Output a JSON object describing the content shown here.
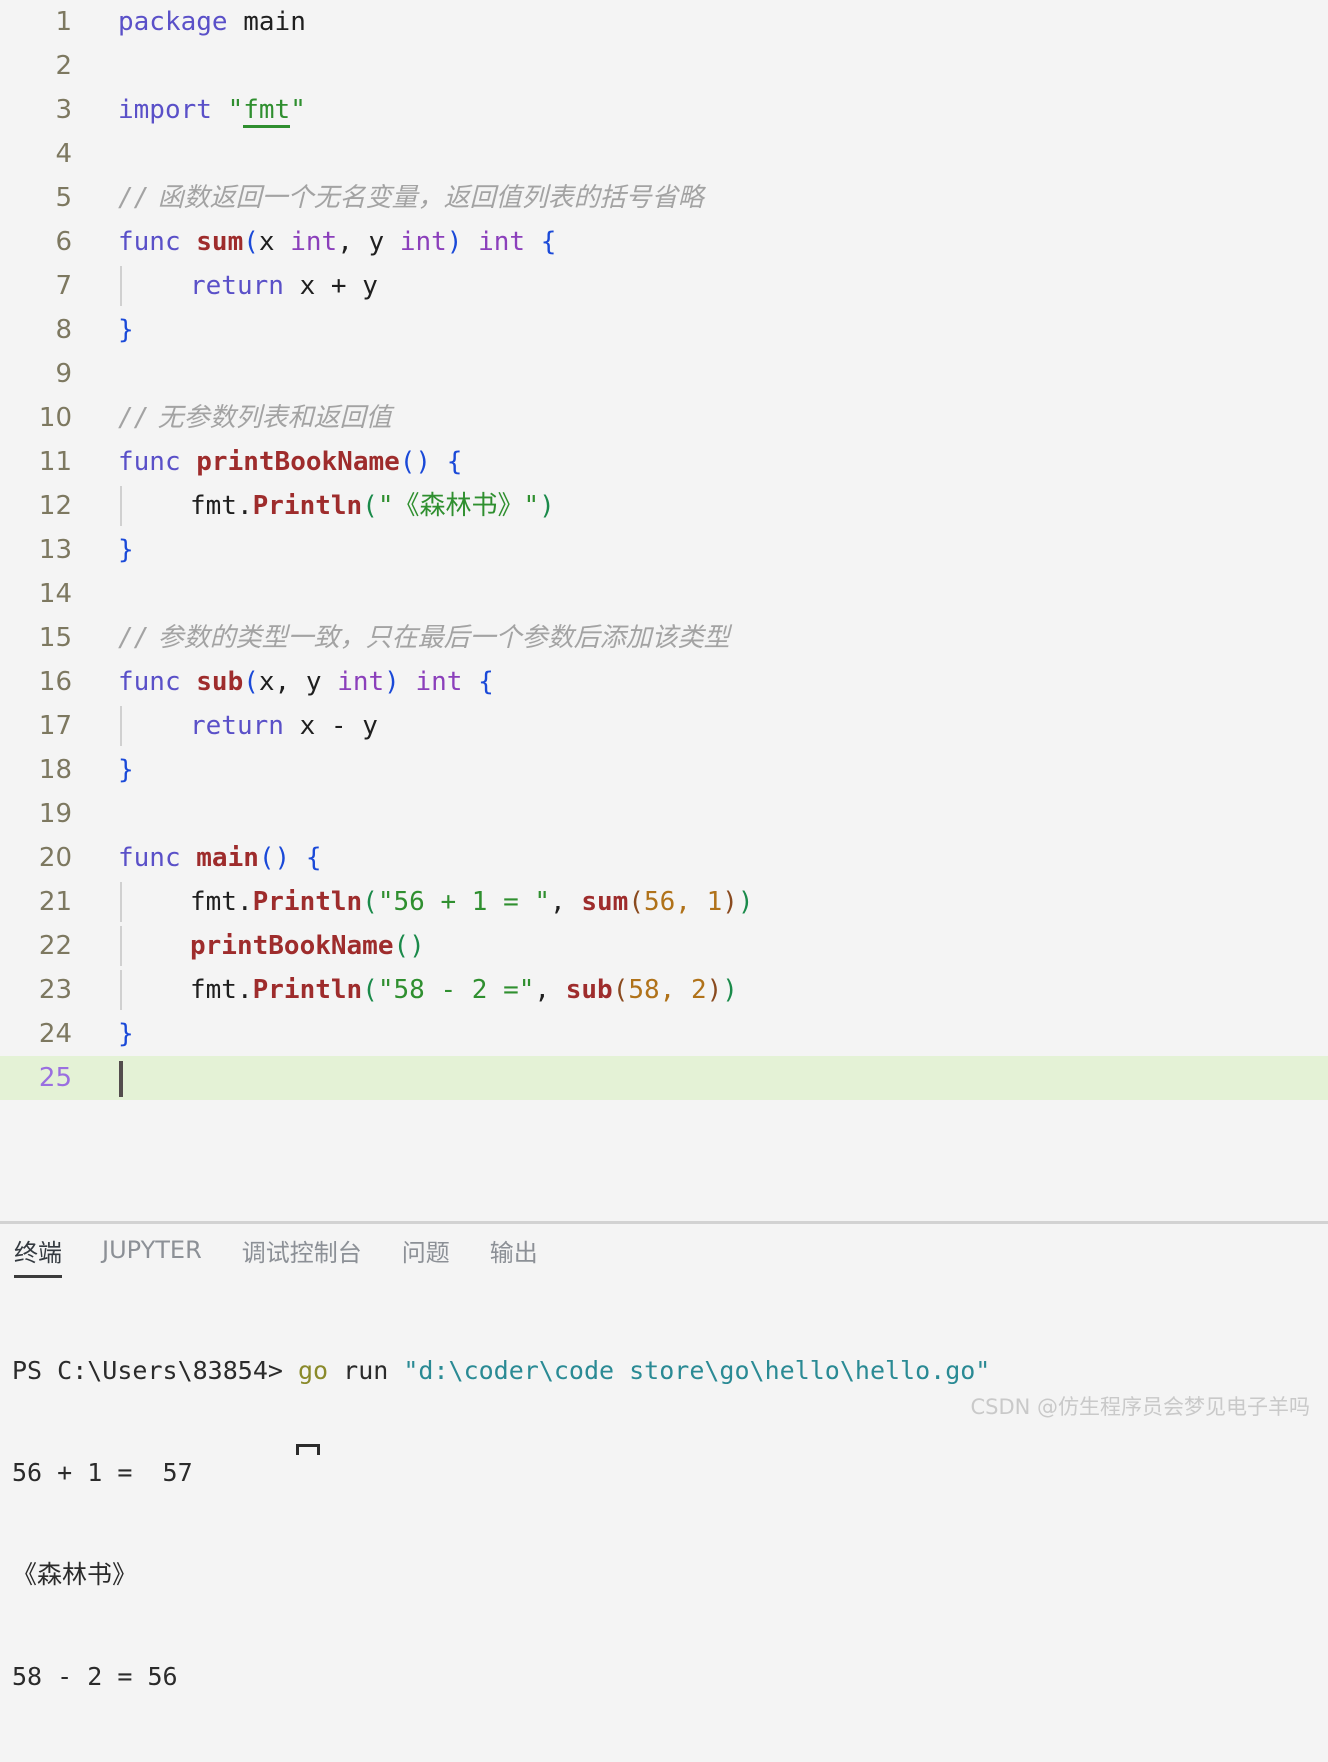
{
  "editor": {
    "language": "go",
    "active_line": 25,
    "total_lines": 25,
    "background": "#f4f4f4",
    "active_line_highlight": "#e4f2d6",
    "line_number_color": "#7d7860",
    "active_line_number_color": "#9a6fe0",
    "lines": [
      {
        "n": "1",
        "text": "package main"
      },
      {
        "n": "2",
        "text": ""
      },
      {
        "n": "3",
        "text": "import \"fmt\""
      },
      {
        "n": "4",
        "text": ""
      },
      {
        "n": "5",
        "text": "// 函数返回一个无名变量，返回值列表的括号省略"
      },
      {
        "n": "6",
        "text": "func sum(x int, y int) int {"
      },
      {
        "n": "7",
        "text": "    return x + y"
      },
      {
        "n": "8",
        "text": "}"
      },
      {
        "n": "9",
        "text": ""
      },
      {
        "n": "10",
        "text": "// 无参数列表和返回值"
      },
      {
        "n": "11",
        "text": "func printBookName() {"
      },
      {
        "n": "12",
        "text": "    fmt.Println(\"《森林书》\")"
      },
      {
        "n": "13",
        "text": "}"
      },
      {
        "n": "14",
        "text": ""
      },
      {
        "n": "15",
        "text": "// 参数的类型一致，只在最后一个参数后添加该类型"
      },
      {
        "n": "16",
        "text": "func sub(x, y int) int {"
      },
      {
        "n": "17",
        "text": "    return x - y"
      },
      {
        "n": "18",
        "text": "}"
      },
      {
        "n": "19",
        "text": ""
      },
      {
        "n": "20",
        "text": "func main() {"
      },
      {
        "n": "21",
        "text": "    fmt.Println(\"56 + 1 = \", sum(56, 1))"
      },
      {
        "n": "22",
        "text": "    printBookName()"
      },
      {
        "n": "23",
        "text": "    fmt.Println(\"58 - 2 =\", sub(58, 2))"
      },
      {
        "n": "24",
        "text": "}"
      },
      {
        "n": "25",
        "text": ""
      }
    ],
    "tokens": {
      "l1_kw": "package",
      "l1_name": "main",
      "l3_kw": "import",
      "l3_q1": "\"",
      "l3_pkg": "fmt",
      "l3_q2": "\"",
      "l5_comment_slashes": "//",
      "l5_comment_text": "函数返回一个无名变量，返回值列表的括号省略",
      "l6_kw": "func",
      "l6_fn": "sum",
      "l6_open": "(",
      "l6_p1": "x ",
      "l6_t1": "int",
      "l6_sep": ", ",
      "l6_p2": "y ",
      "l6_t2": "int",
      "l6_close": ")",
      "l6_ret": "int",
      "l6_brace": "{",
      "l7_kw": "return",
      "l7_expr": "x + y",
      "l8_brace": "}",
      "l10_comment_slashes": "//",
      "l10_comment_text": "无参数列表和返回值",
      "l11_kw": "func",
      "l11_fn": "printBookName",
      "l11_parens": "()",
      "l11_brace": "{",
      "l12_pkg": "fmt.",
      "l12_fn": "Println",
      "l12_open": "(",
      "l12_str": "\"《森林书》\"",
      "l12_close": ")",
      "l13_brace": "}",
      "l15_comment_slashes": "//",
      "l15_comment_text": "参数的类型一致，只在最后一个参数后添加该类型",
      "l16_kw": "func",
      "l16_fn": "sub",
      "l16_open": "(",
      "l16_params": "x, y ",
      "l16_t": "int",
      "l16_close": ")",
      "l16_ret": "int",
      "l16_brace": "{",
      "l17_kw": "return",
      "l17_expr": "x - y",
      "l18_brace": "}",
      "l20_kw": "func",
      "l20_fn": "main",
      "l20_parens": "()",
      "l20_brace": "{",
      "l21_pkg": "fmt.",
      "l21_fn": "Println",
      "l21_open": "(",
      "l21_str": "\"56 + 1 = \"",
      "l21_comma": ", ",
      "l21_call": "sum",
      "l21_copen": "(",
      "l21_n1": "56",
      "l21_csep": ", ",
      "l21_n2": "1",
      "l21_cclose": ")",
      "l21_close": ")",
      "l22_fn": "printBookName",
      "l22_parens": "()",
      "l23_pkg": "fmt.",
      "l23_fn": "Println",
      "l23_open": "(",
      "l23_str": "\"58 - 2 =\"",
      "l23_comma": ", ",
      "l23_call": "sub",
      "l23_copen": "(",
      "l23_n1": "58",
      "l23_csep": ", ",
      "l23_n2": "2",
      "l23_cclose": ")",
      "l23_close": ")",
      "l24_brace": "}"
    }
  },
  "panel": {
    "tabs": [
      {
        "label": "终端",
        "active": true
      },
      {
        "label": "JUPYTER",
        "active": false
      },
      {
        "label": "调试控制台",
        "active": false
      },
      {
        "label": "问题",
        "active": false
      },
      {
        "label": "输出",
        "active": false
      }
    ],
    "terminal": {
      "prompt": "PS C:\\Users\\83854> ",
      "command_name": "go",
      "command_arg": " run ",
      "command_path": "\"d:\\coder\\code store\\go\\hello\\hello.go\"",
      "output": [
        "56 + 1 =  57",
        "《森林书》",
        "58 - 2 = 56"
      ],
      "prompt_color": "#2b2b2b",
      "command_color": "#8a8a2b",
      "path_color": "#2a8a94"
    }
  },
  "watermark": "CSDN @仿生程序员会梦见电子羊吗"
}
